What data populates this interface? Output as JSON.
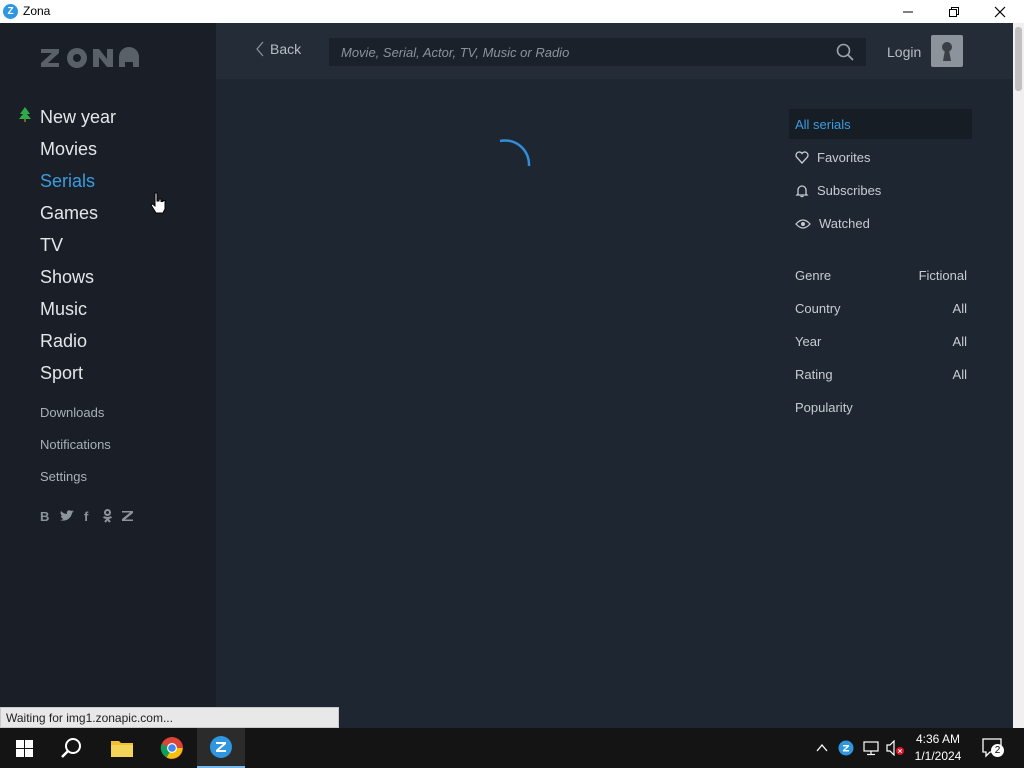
{
  "window": {
    "title": "Zona"
  },
  "sidebar": {
    "logo": "ZONA",
    "nav": [
      {
        "label": "New year",
        "icon": "tree-icon"
      },
      {
        "label": "Movies"
      },
      {
        "label": "Serials",
        "active": true
      },
      {
        "label": "Games"
      },
      {
        "label": "TV"
      },
      {
        "label": "Shows"
      },
      {
        "label": "Music"
      },
      {
        "label": "Radio"
      },
      {
        "label": "Sport"
      }
    ],
    "subnav": [
      "Downloads",
      "Notifications",
      "Settings"
    ],
    "social": [
      "B",
      "twitter-icon",
      "f",
      "odnoklassniki-icon",
      "zona-icon"
    ]
  },
  "topbar": {
    "back_label": "Back",
    "search_placeholder": "Movie, Serial, Actor, TV, Music or Radio",
    "login_label": "Login"
  },
  "filters": {
    "tabs": [
      "All serials",
      "Favorites",
      "Subscribes",
      "Watched"
    ],
    "rows": [
      {
        "label": "Genre",
        "value": "Fictional"
      },
      {
        "label": "Country",
        "value": "All"
      },
      {
        "label": "Year",
        "value": "All"
      },
      {
        "label": "Rating",
        "value": "All"
      },
      {
        "label": "Popularity",
        "value": ""
      }
    ]
  },
  "status_text": "Waiting for img1.zonapic.com...",
  "taskbar": {
    "time": "4:36 AM",
    "date": "1/1/2024",
    "notifications": "2"
  },
  "colors": {
    "accent": "#3b9ce0",
    "sidebar": "#1a1f27",
    "content": "#1e2631"
  }
}
